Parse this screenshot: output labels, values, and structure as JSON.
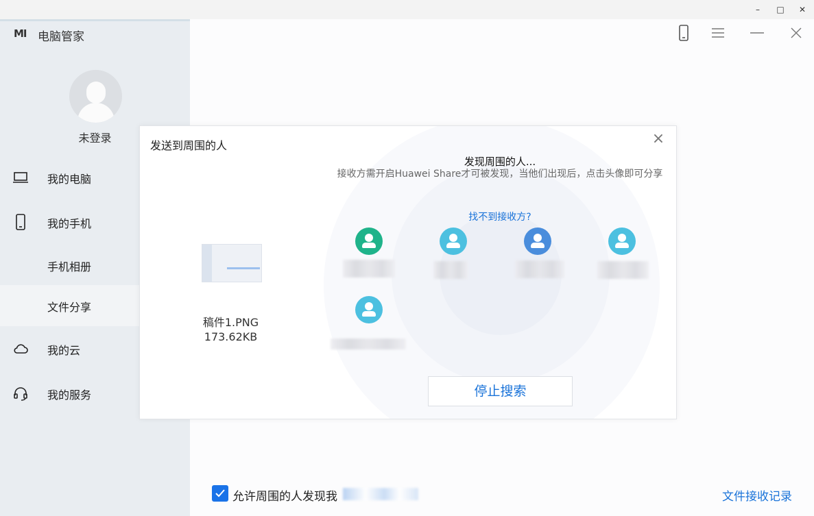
{
  "window": {
    "app_name": "电脑管家",
    "logo": "MI",
    "controls": {
      "minimize": "–",
      "maximize": "□",
      "close": "✕"
    }
  },
  "sidebar": {
    "user_label": "未登录",
    "items": [
      {
        "label": "我的电脑",
        "icon": "laptop-icon"
      },
      {
        "label": "我的手机",
        "icon": "phone-icon"
      },
      {
        "label": "手机相册",
        "icon": ""
      },
      {
        "label": "文件分享",
        "icon": "",
        "selected": true
      },
      {
        "label": "我的云",
        "icon": "cloud-icon"
      },
      {
        "label": "我的服务",
        "icon": "headset-icon"
      }
    ]
  },
  "dialog": {
    "title": "发送到周围的人",
    "file": {
      "name": "稿件1.PNG",
      "size": "173.62KB"
    },
    "heading": "发现周围的人...",
    "subtitle": "接收方需开启Huawei Share才可被发现，当他们出现后，点击头像即可分享",
    "help_link": "找不到接收方?",
    "stop_button": "停止搜索",
    "people_colors": [
      "#1fb38a",
      "#4cc0e0",
      "#4a8ddc",
      "#4cc0e0",
      "#4cc0e0"
    ]
  },
  "footer": {
    "allow_label": "允许周围的人发现我",
    "allow_checked": true,
    "records_link": "文件接收记录"
  }
}
